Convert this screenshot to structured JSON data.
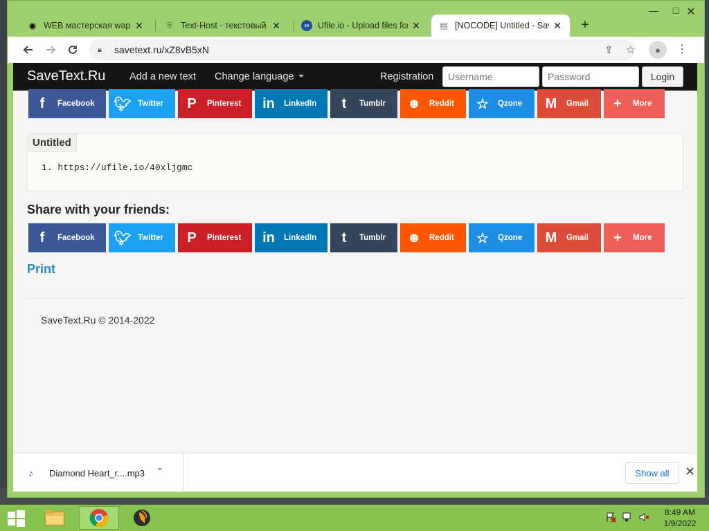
{
  "browser": {
    "tabs": [
      {
        "title": "WEB мастерская wapinet",
        "favicon": "eye-icon",
        "active": false
      },
      {
        "title": "Text-Host - текстовый хостинг",
        "favicon": "shield-icon",
        "active": false
      },
      {
        "title": "Ufile.io - Upload files for free",
        "favicon": "ufile-icon",
        "active": false
      },
      {
        "title": "[NOCODE] Untitled - SaveText.Ru",
        "favicon": "document-icon",
        "active": true
      }
    ],
    "new_tab": "+",
    "url": "savetext.ru/xZ8vB5xN"
  },
  "site": {
    "brand": "SaveText.Ru",
    "nav": {
      "add_text": "Add a new text",
      "change_language": "Change language",
      "registration": "Registration",
      "username_placeholder": "Username",
      "password_placeholder": "Password",
      "login": "Login"
    },
    "share_buttons": [
      {
        "label": "Facebook",
        "color": "#3b5998",
        "icon": "facebook-icon"
      },
      {
        "label": "Twitter",
        "color": "#1da1f2",
        "icon": "twitter-icon"
      },
      {
        "label": "Pinterest",
        "color": "#cb2027",
        "icon": "pinterest-icon"
      },
      {
        "label": "LinkedIn",
        "color": "#0077b5",
        "icon": "linkedin-icon"
      },
      {
        "label": "Tumblr",
        "color": "#35465c",
        "icon": "tumblr-icon"
      },
      {
        "label": "Reddit",
        "color": "#ff5700",
        "icon": "reddit-icon"
      },
      {
        "label": "Qzone",
        "color": "#1d8ee4",
        "icon": "qzone-icon"
      },
      {
        "label": "Gmail",
        "color": "#dd4b39",
        "icon": "gmail-icon"
      },
      {
        "label": "More",
        "color": "#f05f57",
        "icon": "plus-icon"
      }
    ],
    "document": {
      "title": "Untitled",
      "line_number": "1.",
      "line_text": "https://ufile.io/40xljgmc"
    },
    "share_heading": "Share with your friends:",
    "print": "Print",
    "copyright": "SaveText.Ru © 2014-2022"
  },
  "downloads": {
    "file_name": "Diamond Heart_r....mp3",
    "show_all": "Show all"
  },
  "taskbar": {
    "time": "8:49 AM",
    "date": "1/9/2022"
  }
}
